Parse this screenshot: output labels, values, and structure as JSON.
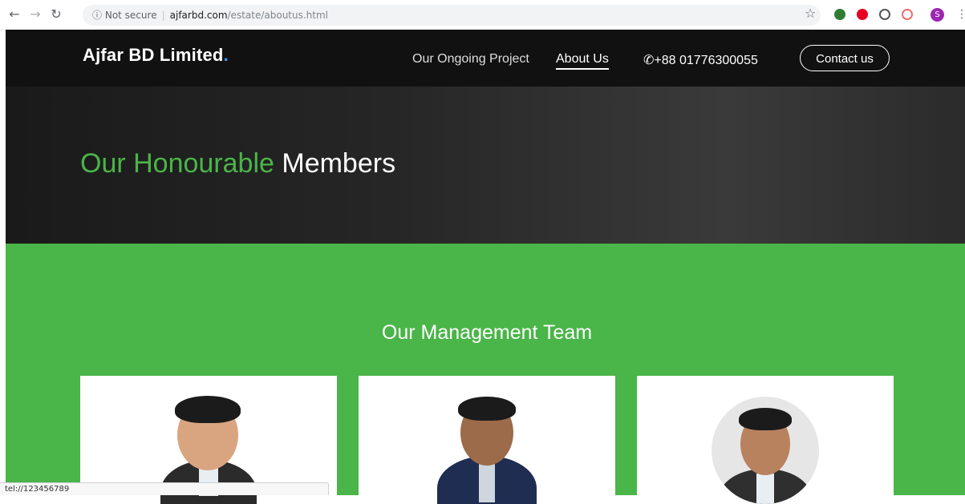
{
  "browser": {
    "back_icon": "arrow-left-icon",
    "forward_icon": "arrow-right-icon",
    "reload_icon": "reload-icon",
    "security_label": "Not secure",
    "url_host": "ajfarbd.com",
    "url_path": "/estate/aboutus.html",
    "profile_initial": "S",
    "status_text": "tel://123456789"
  },
  "site": {
    "logo_text": "Ajfar BD Limited",
    "logo_dot": ".",
    "nav": [
      {
        "label": "Our Ongoing Project"
      },
      {
        "label": "About Us"
      }
    ],
    "phone": "+88 01776300055",
    "contact_label": "Contact us"
  },
  "hero": {
    "title_green": "Our Honourable",
    "title_white": "Members"
  },
  "team": {
    "title": "Our Management Team"
  },
  "colors": {
    "brand_green": "#4ab548",
    "header_bg": "#111111",
    "logo_dot": "#3b9cff"
  }
}
